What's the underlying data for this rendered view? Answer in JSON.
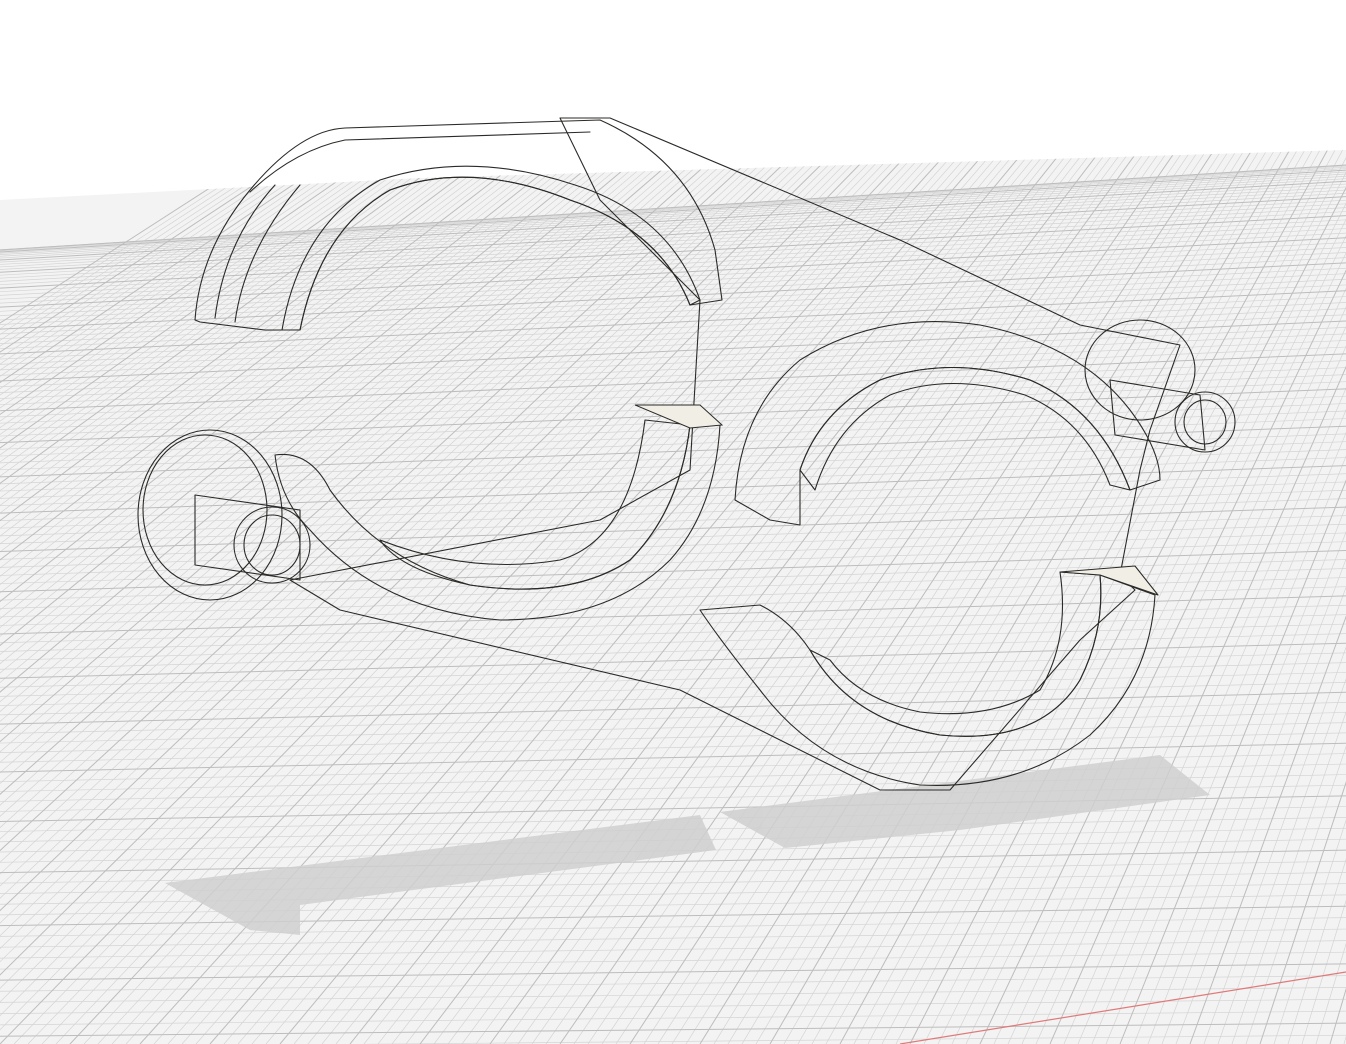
{
  "scene": {
    "model_color": "#e6e2d6",
    "model_shade_color": "#d2cdbd",
    "edge_color": "#2b2a27",
    "background_color": "#ffffff",
    "ground_grid_color": "#c9c9c9",
    "ground_color": "#f4f4f4",
    "shadow_color": "#cfcfcf",
    "axis_color": "#e07070"
  }
}
